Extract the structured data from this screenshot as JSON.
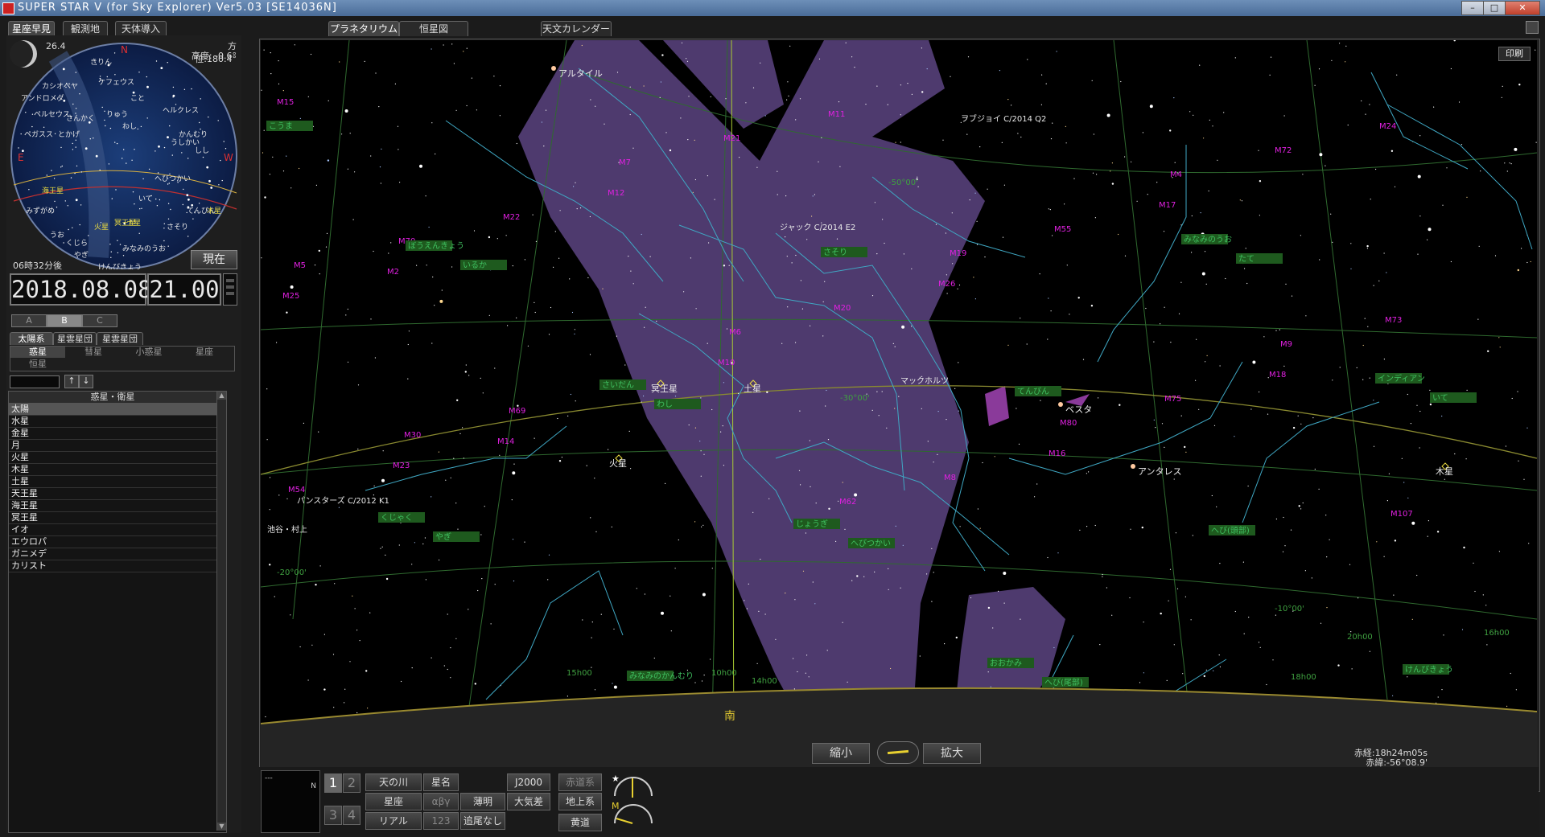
{
  "window": {
    "title": "SUPER STAR V (for Sky Explorer) Ver5.03 [SE14036N]",
    "min": "–",
    "max": "□",
    "close": "✕"
  },
  "left_tabs": [
    "星座早見",
    "観測地",
    "天体導入"
  ],
  "main_tabs": [
    "プラネタリウム",
    "恒星図",
    "天文カレンダー"
  ],
  "minisky": {
    "moon_age": "26.4",
    "azimuth": "方位:180.4°",
    "altitude": "高度: -0.6°",
    "labels": [
      "きりん",
      "カシオペヤ",
      "アンドロメダ",
      "ケフェウス",
      "ペルセウス",
      "さんかく",
      "ペガスス",
      "こと",
      "ヘルクレス",
      "わし",
      "うしかい",
      "りゅう",
      "かんむり",
      "とかげ",
      "しし",
      "いて",
      "てんびん",
      "さそり",
      "へびつかい",
      "海王星",
      "みずがめ",
      "うお",
      "くじら",
      "やぎ",
      "火星",
      "冥王星",
      "土星",
      "木星",
      "みなみのうお",
      "けんびきょう"
    ],
    "dirs": {
      "N": "N",
      "E": "E",
      "W": "W"
    }
  },
  "time_offset": "06時32分後",
  "now_button": "現在",
  "date": "2018.08.08",
  "time": "21.00",
  "abc_buttons": [
    "A",
    "B",
    "C"
  ],
  "category_tabs": [
    "太陽系",
    "星雲星団",
    "星雲星団"
  ],
  "subtabs": [
    "惑星",
    "彗星",
    "小惑星",
    "星座",
    "恒星"
  ],
  "search": {
    "value": "",
    "up": "↑",
    "down": "↓"
  },
  "planet_list": {
    "header": "惑星・衛星",
    "items": [
      "太陽",
      "水星",
      "金星",
      "月",
      "火星",
      "木星",
      "土星",
      "天王星",
      "海王星",
      "冥王星",
      "イオ",
      "エウロパ",
      "ガニメデ",
      "カリスト"
    ],
    "selected": 0
  },
  "sky": {
    "print_button": "印刷",
    "south": "南",
    "ra_readout": "赤経:18h24m05s",
    "dec_readout": "赤緯:-56°08.9'",
    "stars_named": [
      "アルタイル",
      "ベスタ",
      "アンタレス"
    ],
    "planets": [
      "冥王星",
      "土星",
      "火星",
      "木星"
    ],
    "comets": [
      "ヲブジョイ C/2014 Q2",
      "ジャック C/2014 E2",
      "マックホルツ",
      "パンスターズ C/2012 K1"
    ],
    "observers": [
      "池谷・村上"
    ],
    "messier": [
      "M15",
      "M2",
      "M14",
      "M12",
      "M10",
      "M11",
      "M26",
      "M16",
      "M17",
      "M18",
      "M24",
      "M25",
      "M23",
      "M22",
      "M28",
      "M21",
      "M20",
      "M8",
      "M55",
      "M75",
      "M72",
      "M73",
      "M54",
      "M70",
      "M69",
      "M7",
      "M6",
      "M62",
      "M19",
      "M80",
      "M4",
      "M9",
      "M107",
      "M5",
      "M30"
    ],
    "constellations": [
      "こうま",
      "いるか",
      "わし",
      "へびつかい",
      "へび(尾部)",
      "たて",
      "いて",
      "やぎ",
      "みなみのかんむり",
      "さそり",
      "てんびん",
      "へび(頭部)",
      "けんびきょう",
      "ぼうえんきょう",
      "さいだん",
      "じょうぎ",
      "おおかみ",
      "みなみのうお",
      "インディアン",
      "くじゃく"
    ],
    "dec_labels": [
      "-20°00'",
      "-30°00'",
      "-50°00'",
      "-10°00'"
    ],
    "ra_labels": [
      "20h00",
      "18h00",
      "16h00",
      "15h00",
      "14h00",
      "10h00"
    ],
    "zoom_out": "縮小",
    "zoom_in": "拡大"
  },
  "bottom": {
    "preview_text": "---",
    "preview_n": "N",
    "pages": [
      "1",
      "2",
      "3",
      "4"
    ],
    "buttons_row1": [
      "天の川",
      "星名",
      "",
      "J2000",
      "赤道系"
    ],
    "buttons_row2": [
      "星座",
      "αβγ",
      "薄明",
      "大気差",
      "地上系"
    ],
    "buttons_row3": [
      "リアル",
      "123",
      "追尾なし",
      "",
      "黄道"
    ],
    "gauge_star": "★",
    "gauge_m": "M"
  },
  "colors": {
    "milkyway": "#5a3f7a",
    "constellation_line": "#3fa8c4",
    "grid_line": "#2f6a2f",
    "ecliptic": "#9a9a40",
    "messier": "#e020e0",
    "label_bg": "#1e5a1e"
  }
}
